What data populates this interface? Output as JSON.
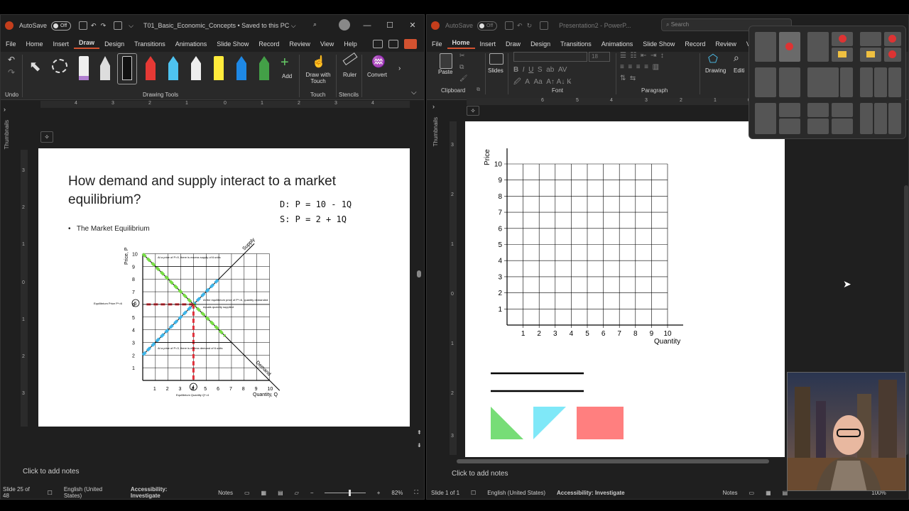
{
  "left_window": {
    "autosave_label": "AutoSave",
    "autosave_state": "Off",
    "title": "T01_Basic_Economic_Concepts • Saved to this PC ⌵",
    "menu": [
      "File",
      "Home",
      "Insert",
      "Draw",
      "Design",
      "Transitions",
      "Animations",
      "Slide Show",
      "Record",
      "Review",
      "View",
      "Help"
    ],
    "active_menu": "Draw",
    "ribbon": {
      "undo_label": "Undo",
      "drawing_tools_label": "Drawing Tools",
      "add_label": "Add",
      "draw_with_touch_label": "Draw with Touch",
      "touch_label": "Touch",
      "ruler_label": "Ruler",
      "convert_label": "Convert",
      "stencils_label": "Stencils"
    },
    "ruler_ticks": [
      "4",
      "3",
      "2",
      "1",
      "0",
      "1",
      "2",
      "3",
      "4"
    ],
    "vruler_ticks": [
      "3",
      "2",
      "1",
      "0",
      "1",
      "2",
      "3"
    ],
    "thumbnails_label": "Thumbnails",
    "slide": {
      "title_line1": "How demand and supply interact to a market",
      "title_line2": "equilibrium?",
      "bullet": "The Market Equilibrium",
      "handwriting_d": "D: P = 10 - 1Q",
      "handwriting_s": "S: P = 2 + 1Q",
      "y_axis_label": "Price, P",
      "x_axis_label": "Quantity, Q",
      "supply_label": "Supply",
      "demand_label": "Demand",
      "eq_price_label": "Equilibrium Price P*=6",
      "eq_qty_label": "Equilibrium Quantity Q*=4",
      "excess_supply_note": "At a price of P=9, there is excess supply of 6 units",
      "eq_note1": "At the equilibrium price of P*=6, quantity demanded",
      "eq_note2": "equals quantity supplied",
      "excess_demand_note": "At a price of P=3, there is excess demand of 6 units",
      "y_ticks": [
        "1",
        "2",
        "3",
        "4",
        "5",
        "6",
        "7",
        "8",
        "9",
        "10"
      ],
      "x_ticks": [
        "1",
        "2",
        "3",
        "4",
        "5",
        "6",
        "7",
        "8",
        "9",
        "10"
      ],
      "circled_price": "6",
      "circled_qty": "4"
    },
    "notes_placeholder": "Click to add notes",
    "status": {
      "slide": "Slide 25 of 48",
      "language": "English (United States)",
      "accessibility": "Accessibility: Investigate",
      "notes": "Notes",
      "zoom": "82%"
    }
  },
  "right_window": {
    "autosave_label": "AutoSave",
    "autosave_state": "Off",
    "title": "Presentation2 - PowerP...",
    "search_placeholder": "Search",
    "menu": [
      "File",
      "Home",
      "Insert",
      "Draw",
      "Design",
      "Transitions",
      "Animations",
      "Slide Show",
      "Record",
      "Review",
      "Vi"
    ],
    "active_menu": "Home",
    "ribbon": {
      "paste_label": "Paste",
      "clipboard_label": "Clipboard",
      "slides_label": "Slides",
      "font_label": "Font",
      "font_size": "18",
      "paragraph_label": "Paragraph",
      "drawing_label": "Drawing",
      "editing_label": "Editi"
    },
    "ruler_ticks": [
      "6",
      "5",
      "4",
      "3",
      "2",
      "1",
      "0",
      "1",
      "2"
    ],
    "vruler_ticks": [
      "3",
      "2",
      "1",
      "0",
      "1",
      "2",
      "3"
    ],
    "thumbnails_label": "Thumbnails",
    "slide": {
      "y_axis_label": "Price",
      "x_axis_label": "Quantity",
      "y_ticks": [
        "1",
        "2",
        "3",
        "4",
        "5",
        "6",
        "7",
        "8",
        "9",
        "10"
      ],
      "x_ticks": [
        "1",
        "2",
        "3",
        "4",
        "5",
        "6",
        "7",
        "8",
        "9",
        "10"
      ],
      "swatch_colors": [
        "#77dd77",
        "#7fe8f8",
        "#ff7f7f"
      ]
    },
    "notes_placeholder": "Click to add notes",
    "status": {
      "slide": "Slide 1 of 1",
      "language": "English (United States)",
      "accessibility": "Accessibility: Investigate",
      "notes": "Notes",
      "zoom": "100%"
    }
  },
  "colors": {
    "accent": "#d35230",
    "green": "#77dd44",
    "blue": "#3fb5e8",
    "red": "#e0303a"
  }
}
